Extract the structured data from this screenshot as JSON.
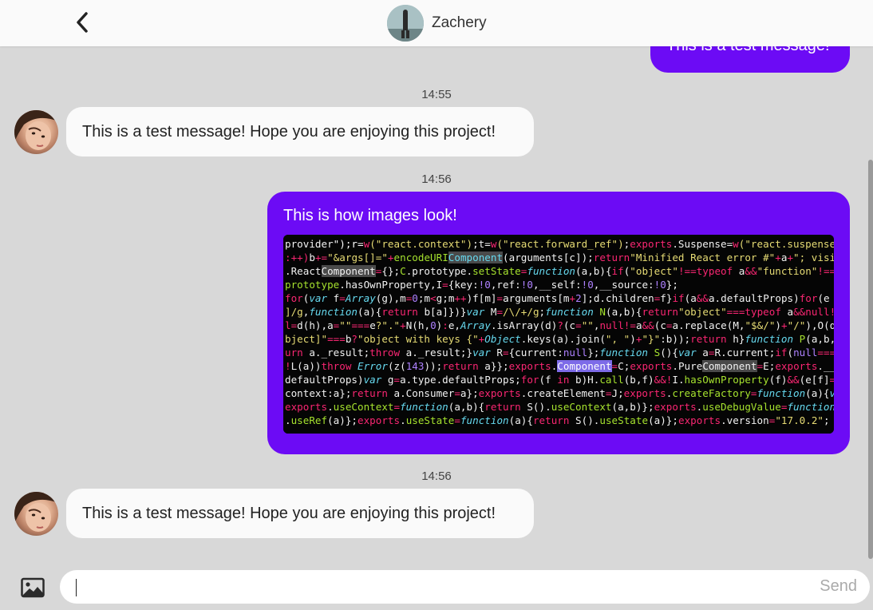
{
  "header": {
    "contact_name": "Zachery"
  },
  "messages": [
    {
      "direction": "outgoing",
      "text": "This is a test message!"
    },
    {
      "timestamp": "14:55",
      "direction": "incoming",
      "text": "This is a test message! Hope you are enjoying this project!"
    },
    {
      "timestamp": "14:56",
      "direction": "outgoing",
      "text": "This is how images look!"
    },
    {
      "timestamp": "14:56",
      "direction": "incoming",
      "text": "This is a test message! Hope you are enjoying this project!"
    }
  ],
  "input": {
    "value": "",
    "send_label": "Send"
  },
  "colors": {
    "outgoing_bubble": "#6c0bf5",
    "incoming_bubble": "#fafafa",
    "background": "#d8d8d8"
  }
}
